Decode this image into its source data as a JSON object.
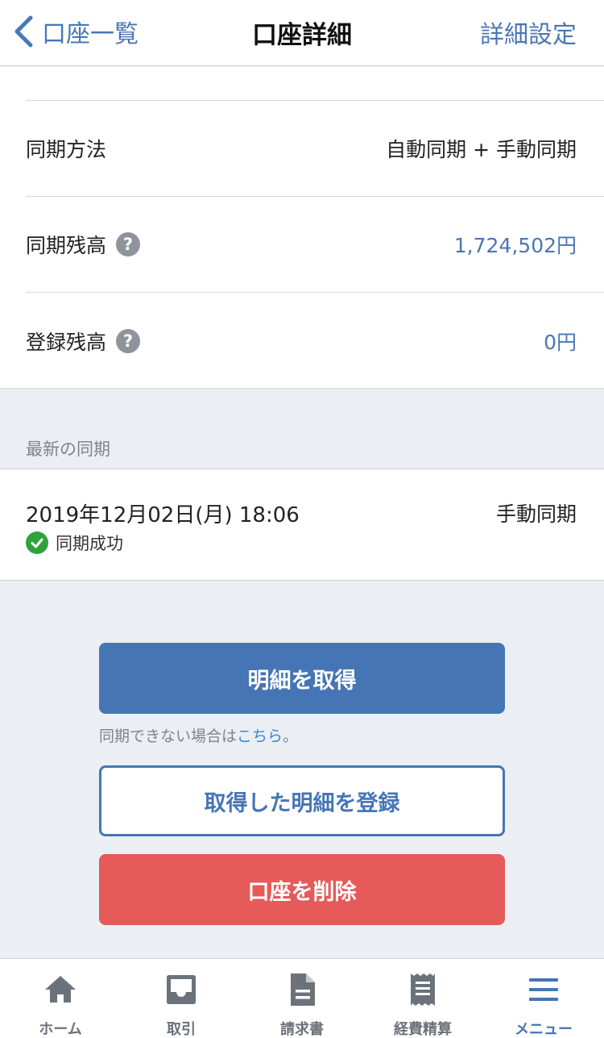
{
  "header": {
    "back_label": "口座一覧",
    "title": "口座詳細",
    "settings_label": "詳細設定"
  },
  "info": {
    "rows": [
      {
        "label": "同期方法",
        "value": "自動同期 + 手動同期"
      },
      {
        "label": "同期残高",
        "value": "1,724,502円"
      },
      {
        "label": "登録残高",
        "value": "0円"
      }
    ],
    "help_glyph": "?"
  },
  "latest_sync": {
    "section_label": "最新の同期",
    "datetime": "2019年12月02日(月) 18:06",
    "method": "手動同期",
    "status": "同期成功"
  },
  "actions": {
    "fetch_label": "明細を取得",
    "helper_text": "同期できない場合は",
    "helper_link": "こちら",
    "helper_suffix": "。",
    "register_label": "取得した明細を登録",
    "delete_label": "口座を削除"
  },
  "tabbar": {
    "items": [
      {
        "label": "ホーム",
        "icon": "home-icon"
      },
      {
        "label": "取引",
        "icon": "inbox-icon"
      },
      {
        "label": "請求書",
        "icon": "document-icon"
      },
      {
        "label": "経費精算",
        "icon": "receipt-icon"
      },
      {
        "label": "メニュー",
        "icon": "menu-icon"
      }
    ],
    "active_index": 4
  },
  "colors": {
    "accent": "#4675b5",
    "danger": "#e65a5a",
    "success": "#2fa33a",
    "background": "#ebeef2"
  }
}
